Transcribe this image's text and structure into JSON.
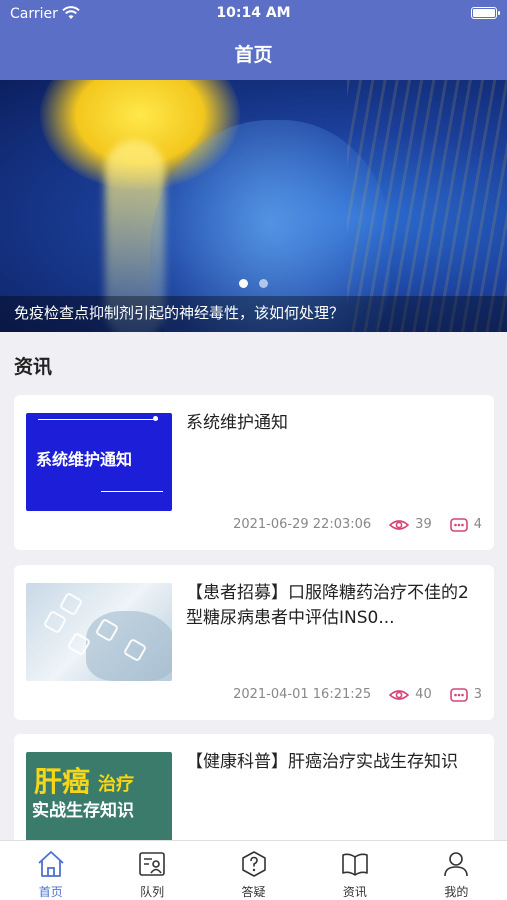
{
  "status_bar": {
    "carrier": "Carrier",
    "time": "10:14 AM"
  },
  "nav": {
    "title": "首页"
  },
  "banner": {
    "caption": "免疫检查点抑制剂引起的神经毒性，该如何处理？",
    "page_count": 2,
    "active_index": 0
  },
  "section": {
    "title": "资讯"
  },
  "news": [
    {
      "title": "系统维护通知",
      "date": "2021-06-29 22:03:06",
      "views": "39",
      "comments": "4",
      "thumb": "notice",
      "thumb_text": "系统维护通知"
    },
    {
      "title": "【患者招募】口服降糖药治疗不佳的2型糖尿病患者中评估INS0...",
      "date": "2021-04-01 16:21:25",
      "views": "40",
      "comments": "3",
      "thumb": "medical"
    },
    {
      "title": "【健康科普】肝癌治疗实战生存知识",
      "thumb": "liver",
      "thumb_text_1": "肝癌",
      "thumb_text_2": "治疗",
      "thumb_text_3": "实战生存知识"
    }
  ],
  "tabs": [
    {
      "label": "首页",
      "icon": "home-icon",
      "active": true
    },
    {
      "label": "队列",
      "icon": "queue-icon",
      "active": false
    },
    {
      "label": "答疑",
      "icon": "question-icon",
      "active": false
    },
    {
      "label": "资讯",
      "icon": "book-icon",
      "active": false
    },
    {
      "label": "我的",
      "icon": "user-icon",
      "active": false
    }
  ],
  "colors": {
    "header": "#5b6fc6",
    "accent": "#4f6fd4",
    "icon_pink": "#d6457a"
  }
}
